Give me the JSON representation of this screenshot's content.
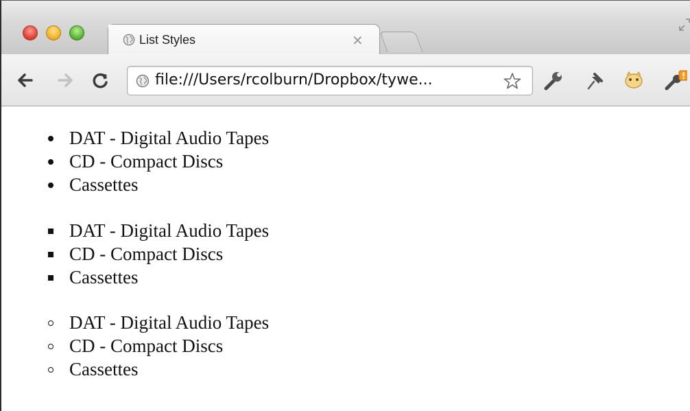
{
  "tab": {
    "title": "List Styles"
  },
  "omnibox": {
    "url": "file:///Users/rcolburn/Dropbox/tywe..."
  },
  "lists": [
    {
      "style": "disc",
      "items": [
        "DAT - Digital Audio Tapes",
        "CD - Compact Discs",
        "Cassettes"
      ]
    },
    {
      "style": "square",
      "items": [
        "DAT - Digital Audio Tapes",
        "CD - Compact Discs",
        "Cassettes"
      ]
    },
    {
      "style": "circle",
      "items": [
        "DAT - Digital Audio Tapes",
        "CD - Compact Discs",
        "Cassettes"
      ]
    }
  ],
  "icons": {
    "close": "close-icon",
    "back": "back-arrow-icon",
    "forward": "forward-arrow-icon",
    "reload": "reload-icon",
    "page": "globe-icon",
    "bookmark": "star-icon"
  },
  "colors": {
    "tab_bg": "#f6f6f6",
    "toolbar_bg": "#ececec",
    "close_red": "#e0443a",
    "minimize_yellow": "#f1b42b",
    "zoom_green": "#5cb83a",
    "badge_orange": "#f39a1e"
  }
}
